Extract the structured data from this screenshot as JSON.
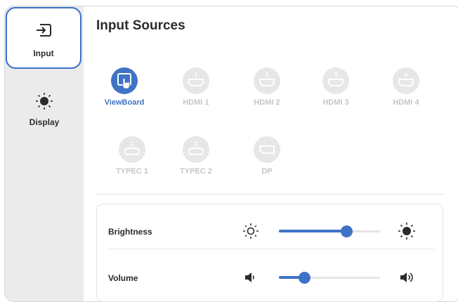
{
  "sidebar": {
    "items": [
      {
        "label": "Input",
        "icon": "input-icon",
        "selected": true
      },
      {
        "label": "Display",
        "icon": "sun-icon",
        "selected": false
      }
    ]
  },
  "main": {
    "title": "Input Sources",
    "sources": [
      {
        "label": "ViewBoard",
        "icon": "viewboard-touch-icon",
        "active": true
      },
      {
        "label": "HDMI 1",
        "icon": "hdmi-icon",
        "number": "1",
        "active": false
      },
      {
        "label": "HDMI 2",
        "icon": "hdmi-icon",
        "number": "2",
        "active": false
      },
      {
        "label": "HDMI 3",
        "icon": "hdmi-icon",
        "number": "3",
        "active": false
      },
      {
        "label": "HDMI 4",
        "icon": "hdmi-icon",
        "number": "4",
        "active": false
      },
      {
        "label": "TYPEC 1",
        "icon": "usb-c-icon",
        "number": "1",
        "active": false
      },
      {
        "label": "TYPEC 2",
        "icon": "usb-c-icon",
        "number": "2",
        "active": false
      },
      {
        "label": "DP",
        "icon": "displayport-icon",
        "active": false
      }
    ]
  },
  "controls": {
    "brightness": {
      "label": "Brightness",
      "value_fraction": 0.67,
      "left_icon": "sun-outline-icon",
      "right_icon": "sun-icon"
    },
    "volume": {
      "label": "Volume",
      "value_fraction": 0.25,
      "left_icon": "volume-low-icon",
      "right_icon": "volume-high-icon"
    }
  },
  "colors": {
    "accent": "#3e73c6",
    "inactive": "#c6c6c6",
    "sidebar_bg": "#ebebeb"
  }
}
